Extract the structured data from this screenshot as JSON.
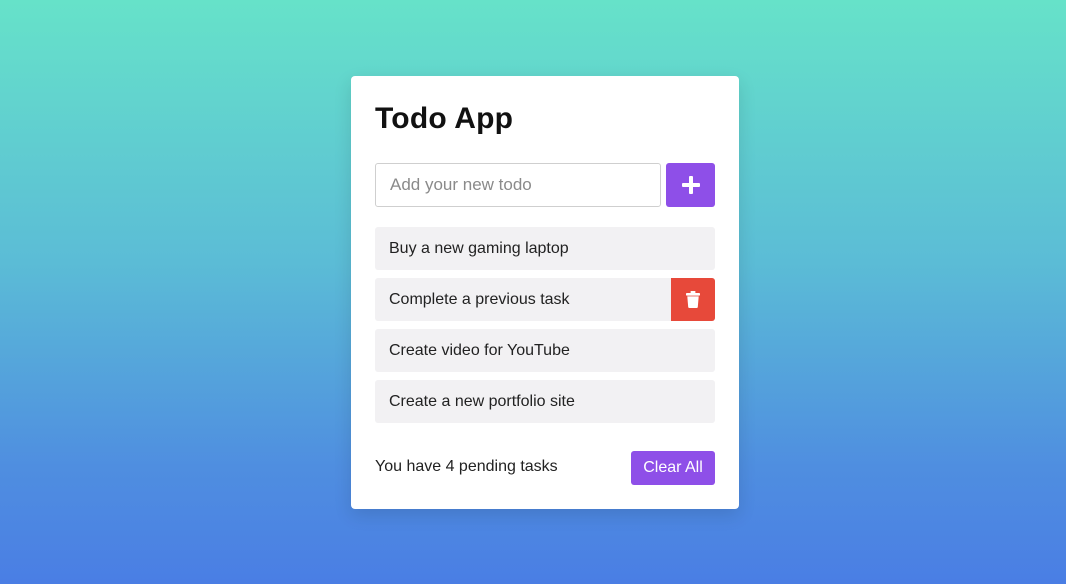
{
  "app": {
    "title": "Todo App"
  },
  "input": {
    "placeholder": "Add your new todo",
    "value": "",
    "add_icon": "plus-icon"
  },
  "todos": [
    {
      "label": "Buy a new gaming laptop"
    },
    {
      "label": "Complete a previous task",
      "delete_icon": "trash-icon"
    },
    {
      "label": "Create video for YouTube"
    },
    {
      "label": "Create a new portfolio site"
    }
  ],
  "footer": {
    "pending_text": "You have 4 pending tasks",
    "clear_label": "Clear All"
  },
  "colors": {
    "accent": "#8e4fe8",
    "danger": "#e7493a",
    "item_bg": "#f2f1f3",
    "gradient_top": "#66e2c9",
    "gradient_bottom": "#4a7ee4"
  }
}
